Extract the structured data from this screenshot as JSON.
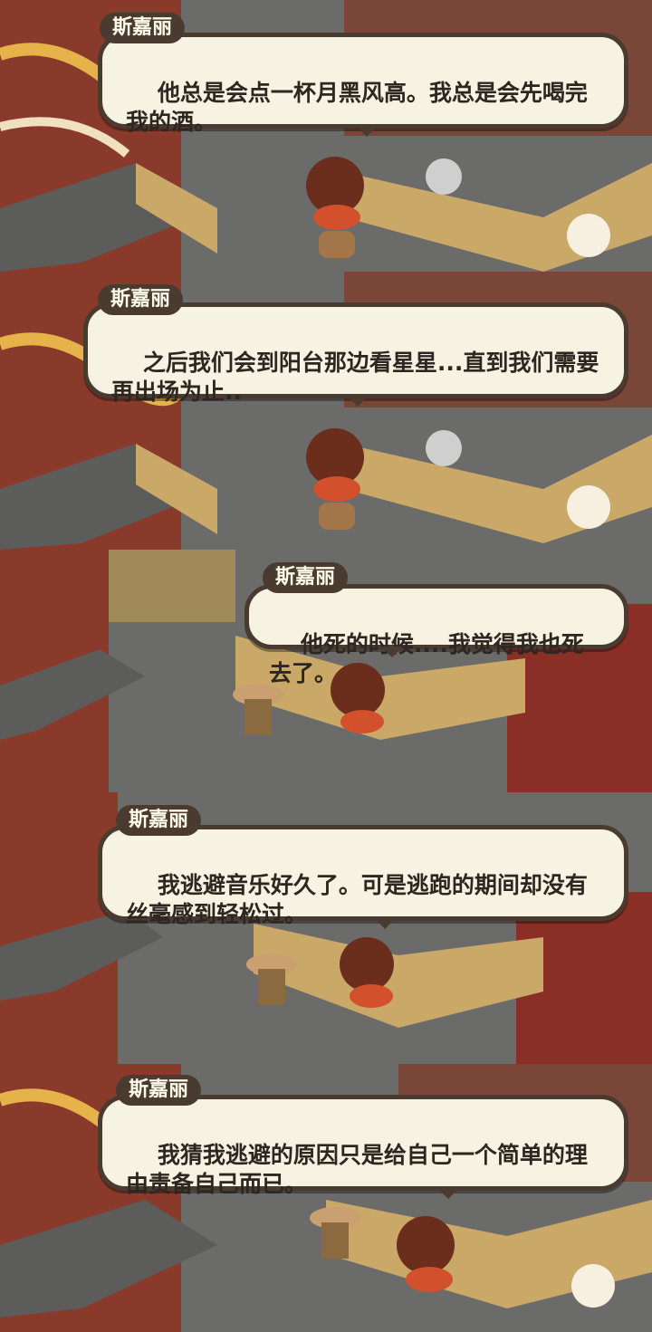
{
  "panels": [
    {
      "speaker": "斯嘉丽",
      "text": "他总是会点一杯月黑风高。我总是会先喝完我的酒。"
    },
    {
      "speaker": "斯嘉丽",
      "text": "之后我们会到阳台那边看星星...直到我们需要再出场为止.."
    },
    {
      "speaker": "斯嘉丽",
      "text": "他死的时候....我觉得我也死去了。"
    },
    {
      "speaker": "斯嘉丽",
      "text": "我逃避音乐好久了。可是逃跑的期间却没有丝毫感到轻松过。"
    },
    {
      "speaker": "斯嘉丽",
      "text": "我猜我逃避的原因只是给自己一个简单的理由责备自己而已。"
    }
  ],
  "colors": {
    "bubble_bg": "#f7f3e3",
    "bubble_border": "#4a3b30",
    "floor": "#6b6c6a",
    "counter": "#c9a868",
    "brick": "#7a4638"
  },
  "icons": [
    "character-scarlett",
    "character-bartender",
    "character-bunny",
    "bar-stool-icon",
    "bar-counter",
    "mural"
  ]
}
